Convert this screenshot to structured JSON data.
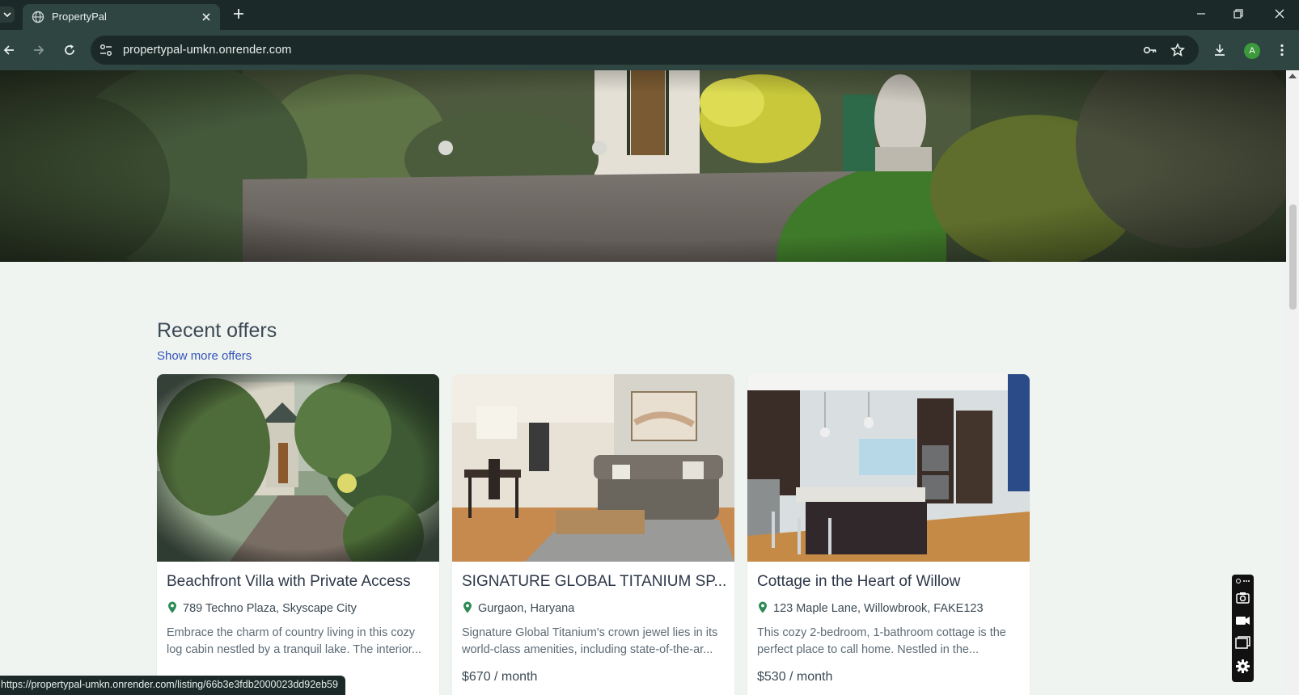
{
  "browser": {
    "tab_title": "PropertyPal",
    "url": "propertypal-umkn.onrender.com",
    "profile_initial": "A",
    "status_url": "https://propertypal-umkn.onrender.com/listing/66b3e3fdb2000023dd92eb59"
  },
  "page": {
    "section_title": "Recent offers",
    "more_link": "Show more offers",
    "cards": [
      {
        "title": "Beachfront Villa with Private Access",
        "address": "789 Techno Plaza, Skyscape City",
        "desc_line1": "Embrace the charm of country living in this cozy",
        "desc_line2": "log cabin nestled by a tranquil lake. The interior...",
        "price": ""
      },
      {
        "title": "SIGNATURE GLOBAL TITANIUM SP...",
        "address": "Gurgaon, Haryana",
        "desc_line1": "Signature Global Titanium's crown jewel lies in its",
        "desc_line2": "world-class amenities, including state-of-the-ar...",
        "price": "$670 / month"
      },
      {
        "title": "Cottage in the Heart of Willow",
        "address": "123 Maple Lane, Willowbrook, FAKE123",
        "desc_line1": "This cozy 2-bedroom, 1-bathroom cottage is the",
        "desc_line2": "perfect place to call home. Nestled in the...",
        "price": "$530 / month"
      }
    ]
  },
  "colors": {
    "chrome_dark": "#1b2a28",
    "chrome_toolbar": "#2e4541",
    "page_bg": "#eff4f1",
    "link": "#3553b8",
    "pin_green": "#2e8b57"
  }
}
